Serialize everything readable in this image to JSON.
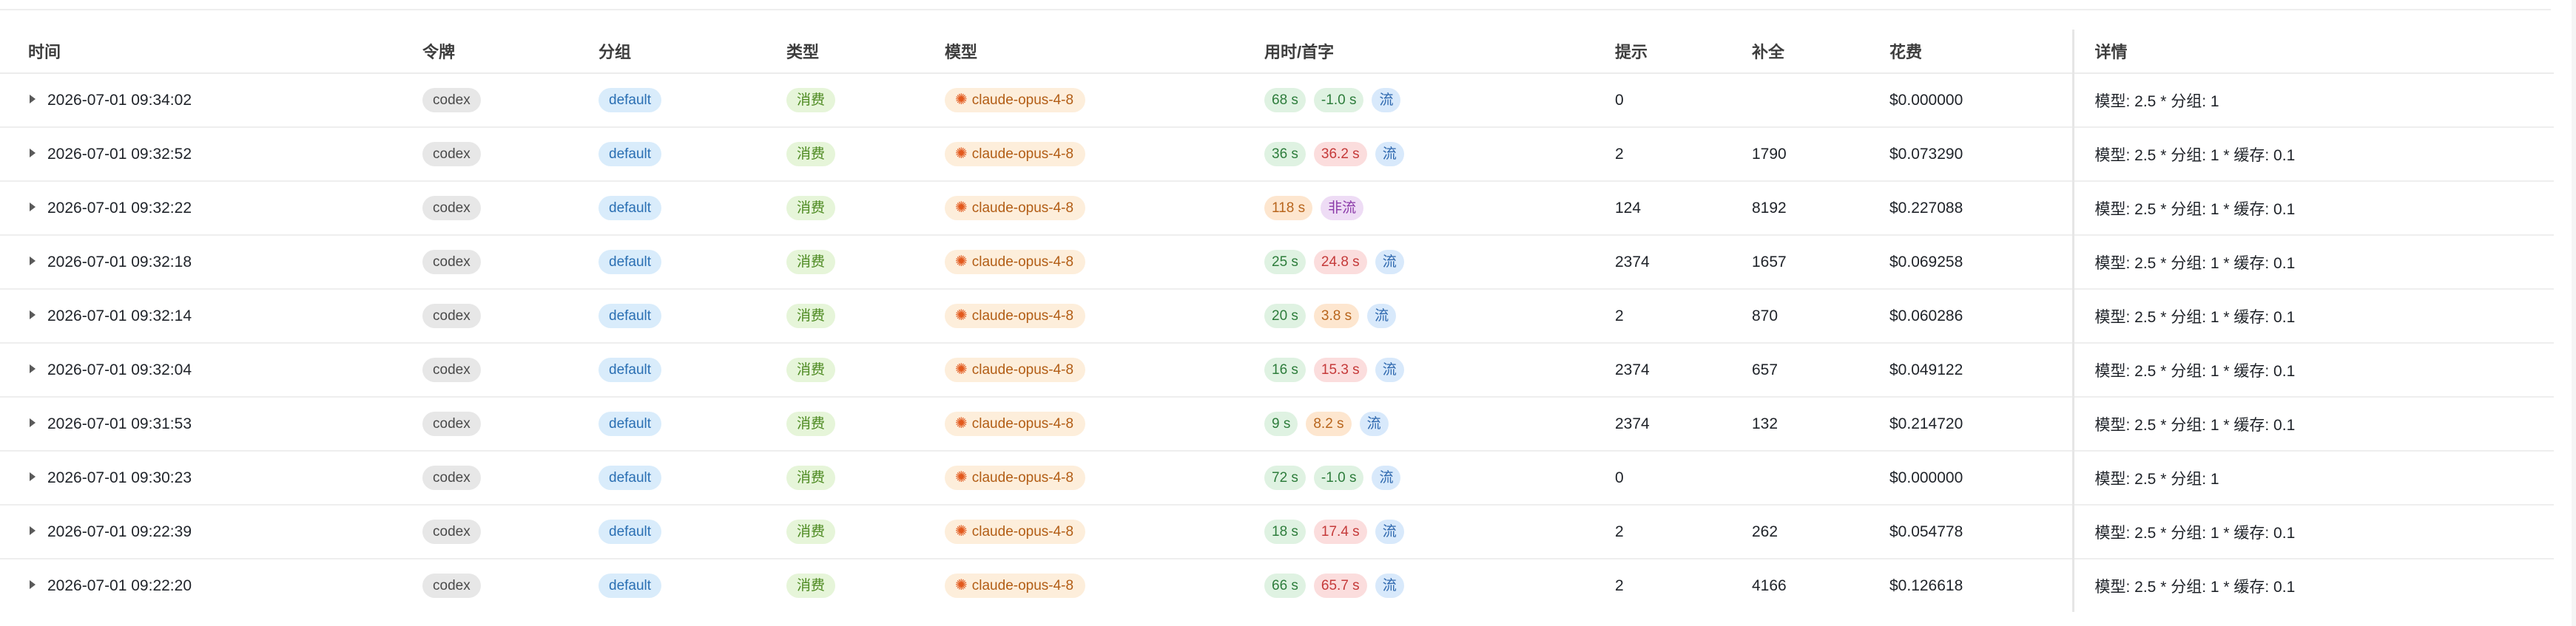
{
  "table": {
    "columns": [
      "时间",
      "令牌",
      "分组",
      "类型",
      "模型",
      "用时/首字",
      "提示",
      "补全",
      "花费",
      "详情"
    ],
    "rows": [
      {
        "time": "2026-07-01 09:34:02",
        "token": "codex",
        "group": "default",
        "type": "消费",
        "model": "claude-opus-4-8",
        "duration": "68 s",
        "first_token": "-1.0 s",
        "first_token_color": "green",
        "stream": "流",
        "prompt": "0",
        "completion": "",
        "cost": "$0.000000",
        "detail": "模型: 2.5 * 分组: 1"
      },
      {
        "time": "2026-07-01 09:32:52",
        "token": "codex",
        "group": "default",
        "type": "消费",
        "model": "claude-opus-4-8",
        "duration": "36 s",
        "first_token": "36.2 s",
        "first_token_color": "red",
        "stream": "流",
        "prompt": "2",
        "completion": "1790",
        "cost": "$0.073290",
        "detail": "模型: 2.5 * 分组: 1 * 缓存: 0.1"
      },
      {
        "time": "2026-07-01 09:32:22",
        "token": "codex",
        "group": "default",
        "type": "消费",
        "model": "claude-opus-4-8",
        "duration": "118 s",
        "duration_color": "orange",
        "first_token": "",
        "stream": "非流",
        "stream_color": "purple",
        "prompt": "124",
        "completion": "8192",
        "cost": "$0.227088",
        "detail": "模型: 2.5 * 分组: 1 * 缓存: 0.1"
      },
      {
        "time": "2026-07-01 09:32:18",
        "token": "codex",
        "group": "default",
        "type": "消费",
        "model": "claude-opus-4-8",
        "duration": "25 s",
        "first_token": "24.8 s",
        "first_token_color": "red",
        "stream": "流",
        "prompt": "2374",
        "completion": "1657",
        "cost": "$0.069258",
        "detail": "模型: 2.5 * 分组: 1 * 缓存: 0.1"
      },
      {
        "time": "2026-07-01 09:32:14",
        "token": "codex",
        "group": "default",
        "type": "消费",
        "model": "claude-opus-4-8",
        "duration": "20 s",
        "first_token": "3.8 s",
        "first_token_color": "orange",
        "stream": "流",
        "prompt": "2",
        "completion": "870",
        "cost": "$0.060286",
        "detail": "模型: 2.5 * 分组: 1 * 缓存: 0.1"
      },
      {
        "time": "2026-07-01 09:32:04",
        "token": "codex",
        "group": "default",
        "type": "消费",
        "model": "claude-opus-4-8",
        "duration": "16 s",
        "first_token": "15.3 s",
        "first_token_color": "red",
        "stream": "流",
        "prompt": "2374",
        "completion": "657",
        "cost": "$0.049122",
        "detail": "模型: 2.5 * 分组: 1 * 缓存: 0.1"
      },
      {
        "time": "2026-07-01 09:31:53",
        "token": "codex",
        "group": "default",
        "type": "消费",
        "model": "claude-opus-4-8",
        "duration": "9 s",
        "first_token": "8.2 s",
        "first_token_color": "orange",
        "stream": "流",
        "prompt": "2374",
        "completion": "132",
        "cost": "$0.214720",
        "detail": "模型: 2.5 * 分组: 1 * 缓存: 0.1"
      },
      {
        "time": "2026-07-01 09:30:23",
        "token": "codex",
        "group": "default",
        "type": "消费",
        "model": "claude-opus-4-8",
        "duration": "72 s",
        "first_token": "-1.0 s",
        "first_token_color": "green",
        "stream": "流",
        "prompt": "0",
        "completion": "",
        "cost": "$0.000000",
        "detail": "模型: 2.5 * 分组: 1"
      },
      {
        "time": "2026-07-01 09:22:39",
        "token": "codex",
        "group": "default",
        "type": "消费",
        "model": "claude-opus-4-8",
        "duration": "18 s",
        "first_token": "17.4 s",
        "first_token_color": "red",
        "stream": "流",
        "prompt": "2",
        "completion": "262",
        "cost": "$0.054778",
        "detail": "模型: 2.5 * 分组: 1 * 缓存: 0.1"
      },
      {
        "time": "2026-07-01 09:22:20",
        "token": "codex",
        "group": "default",
        "type": "消费",
        "model": "claude-opus-4-8",
        "duration": "66 s",
        "first_token": "65.7 s",
        "first_token_color": "red",
        "stream": "流",
        "prompt": "2",
        "completion": "4166",
        "cost": "$0.126618",
        "detail": "模型: 2.5 * 分组: 1 * 缓存: 0.1"
      }
    ]
  },
  "icons": {
    "row_expand": "caret-right-icon",
    "model": "sparkle-icon"
  },
  "colors": {
    "green": "#2e7d3c",
    "red": "#c53a3a",
    "orange": "#b8651d",
    "blue": "#2d67ae",
    "purple": "#8a38a8"
  }
}
